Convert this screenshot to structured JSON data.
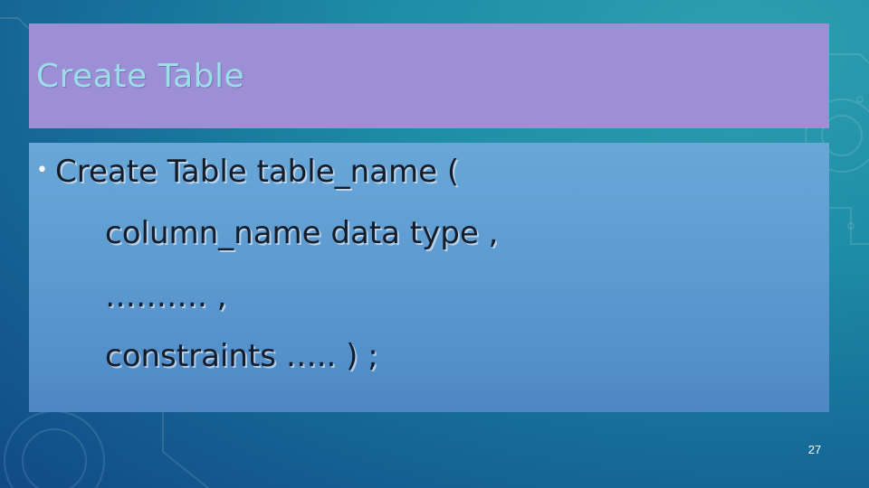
{
  "slide": {
    "title": "Create Table",
    "body": {
      "line1": "Create Table table_name (",
      "line2": "column_name  data type ,",
      "line3": "………. ,",
      "line4": "constraints …..  ) ;"
    },
    "slide_number": "27"
  },
  "colors": {
    "title_bg": "#9d8fd6",
    "title_text": "#9bdde8",
    "content_bg": "#5c9ad0",
    "body_text": "#141c2a",
    "background": "#1a6fa0"
  }
}
